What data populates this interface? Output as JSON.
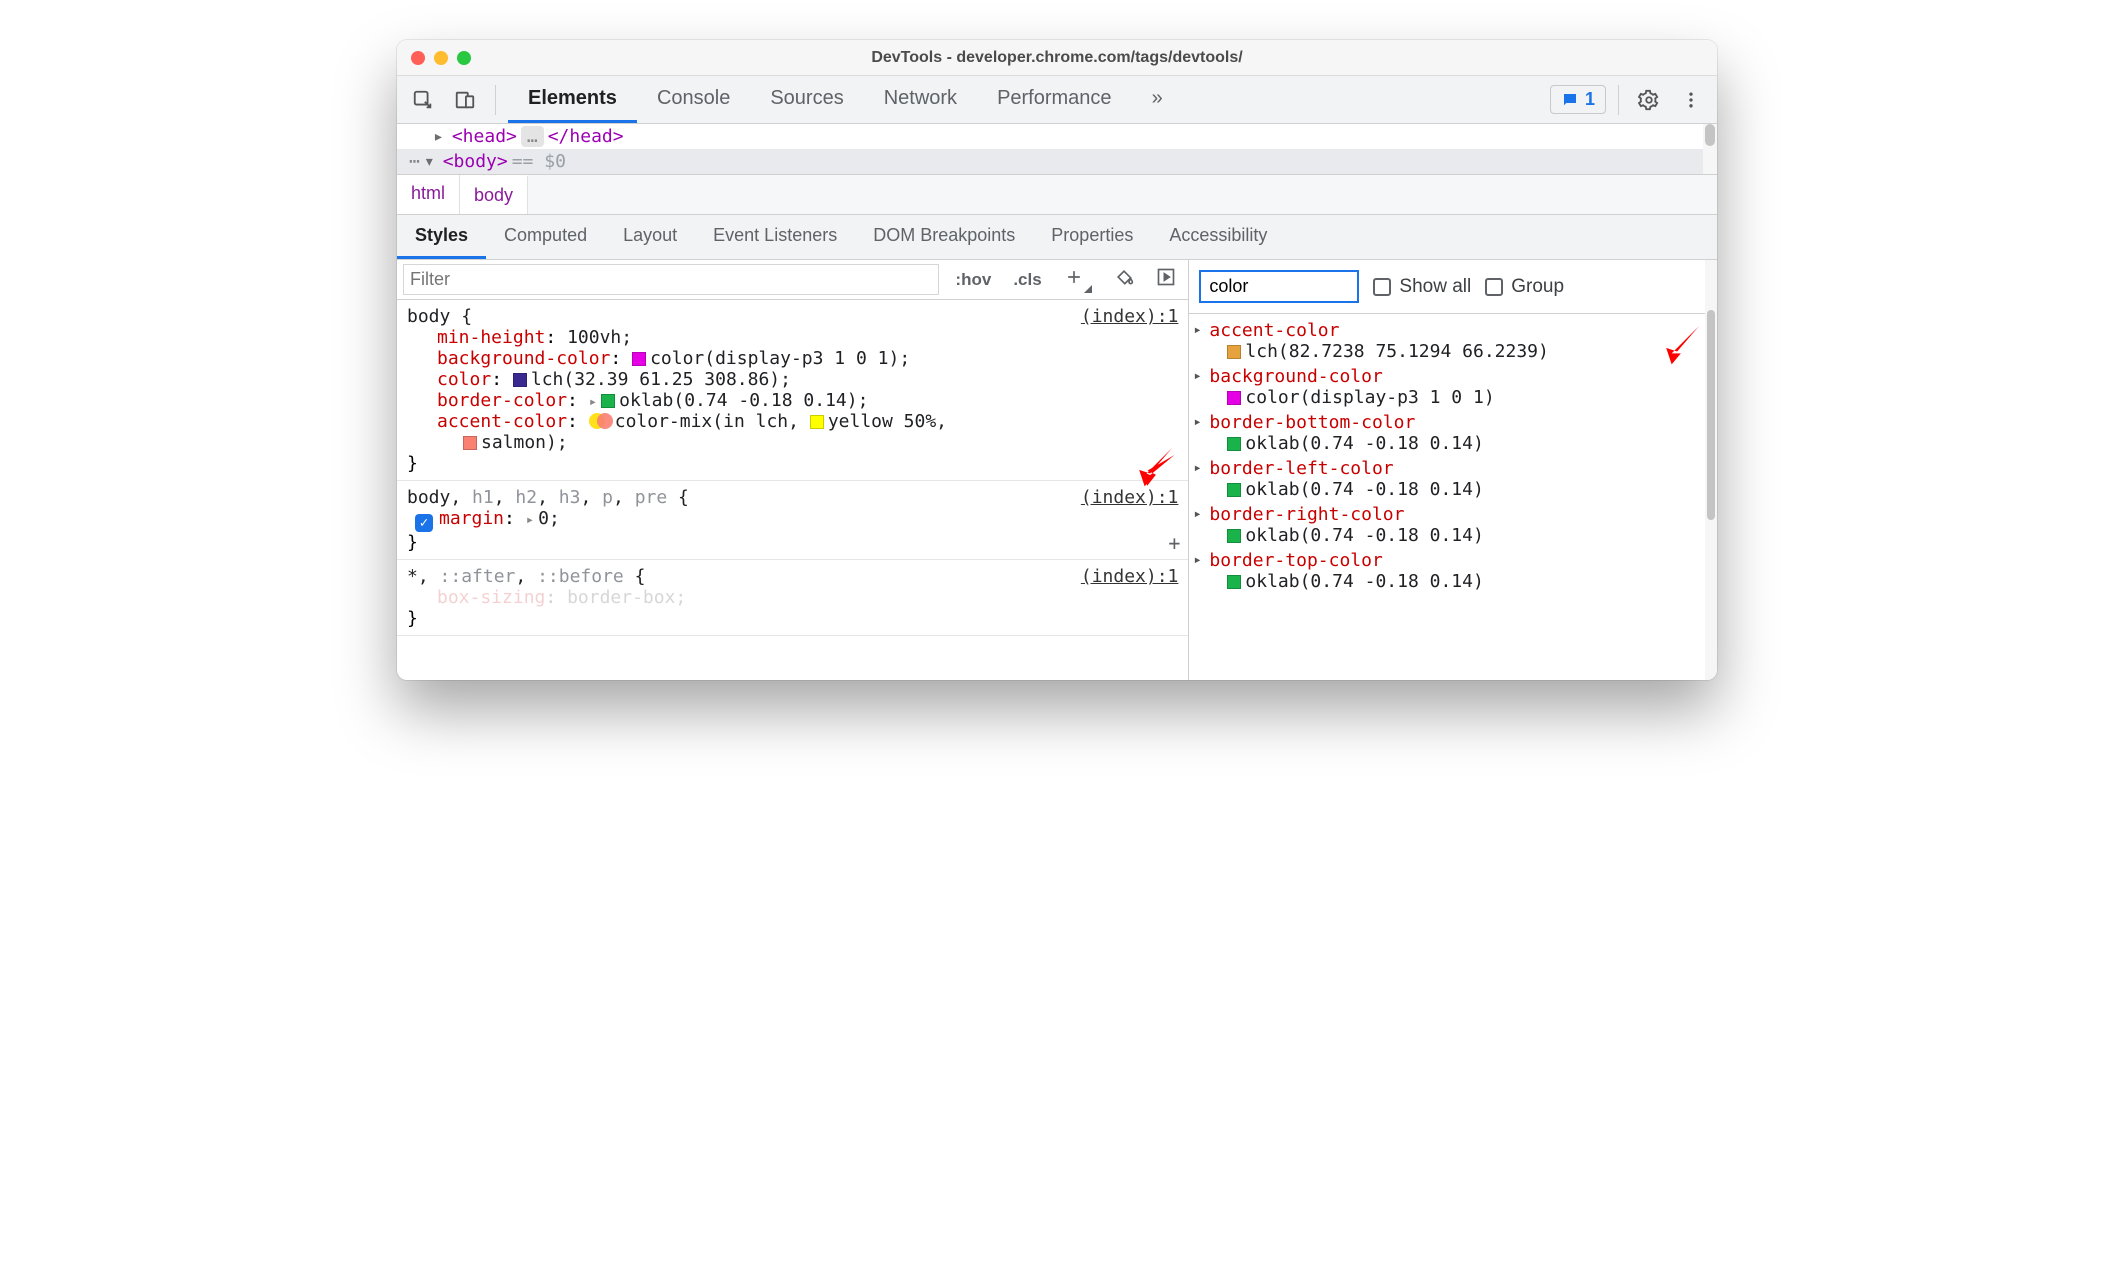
{
  "titlebar": {
    "title": "DevTools - developer.chrome.com/tags/devtools/"
  },
  "toolbar": {
    "tabs": [
      "Elements",
      "Console",
      "Sources",
      "Network",
      "Performance"
    ],
    "more_glyph": "»",
    "badge_count": "1"
  },
  "dom": {
    "head_open": "<head>",
    "head_close": "</head>",
    "ellipsis": "…",
    "dots": "⋯",
    "body_open": "<body>",
    "eq": "== $0"
  },
  "crumbs": [
    "html",
    "body"
  ],
  "subtabs": [
    "Styles",
    "Computed",
    "Layout",
    "Event Listeners",
    "DOM Breakpoints",
    "Properties",
    "Accessibility"
  ],
  "styles_bar": {
    "filter_placeholder": "Filter",
    "hov": ":hov",
    "cls": ".cls"
  },
  "rules": [
    {
      "selector_parts": [
        {
          "t": "body",
          "dim": false
        }
      ],
      "source": "(index):1",
      "decls": [
        {
          "name": "min-height",
          "value": "100vh"
        },
        {
          "name": "background-color",
          "swatch": "#e600e6",
          "value": "color(display-p3 1 0 1)"
        },
        {
          "name": "color",
          "swatch": "#3a2a8f",
          "value": "lch(32.39 61.25 308.86)"
        },
        {
          "name": "border-color",
          "arrow": true,
          "swatch": "#19b24b",
          "value": "oklab(0.74 -0.18 0.14)"
        },
        {
          "name": "accent-color",
          "circles": true,
          "value_pre": "color-mix(in lch, ",
          "mix_swatch": "#ffff00",
          "mix_text": "yellow 50%,",
          "cont_swatch": "#fa8072",
          "cont_text": "salmon)"
        }
      ]
    },
    {
      "selector_parts": [
        {
          "t": "body",
          "dim": false
        },
        {
          "t": ", ",
          "dim": false
        },
        {
          "t": "h1",
          "dim": true
        },
        {
          "t": ", ",
          "dim": false
        },
        {
          "t": "h2",
          "dim": true
        },
        {
          "t": ", ",
          "dim": false
        },
        {
          "t": "h3",
          "dim": true
        },
        {
          "t": ", ",
          "dim": false
        },
        {
          "t": "p",
          "dim": true
        },
        {
          "t": ", ",
          "dim": false
        },
        {
          "t": "pre",
          "dim": true
        }
      ],
      "source": "(index):1",
      "decls": [
        {
          "checked": true,
          "name": "margin",
          "arrow": true,
          "value": "0"
        }
      ],
      "addbtn": true
    },
    {
      "selector_parts": [
        {
          "t": "*",
          "dim": false
        },
        {
          "t": ", ",
          "dim": false
        },
        {
          "t": "::after",
          "dim": true
        },
        {
          "t": ", ",
          "dim": false
        },
        {
          "t": "::before",
          "dim": true
        }
      ],
      "source": "(index):1",
      "decls": [
        {
          "name": "box-sizing",
          "value": "border-box",
          "faded": true
        }
      ]
    }
  ],
  "computed": {
    "filter_value": "color",
    "show_all": "Show all",
    "group": "Group",
    "rows": [
      {
        "name": "accent-color",
        "swatch": "#e6a23c",
        "value": "lch(82.7238 75.1294 66.2239)"
      },
      {
        "name": "background-color",
        "swatch": "#e600e6",
        "value": "color(display-p3 1 0 1)"
      },
      {
        "name": "border-bottom-color",
        "swatch": "#19b24b",
        "value": "oklab(0.74 -0.18 0.14)"
      },
      {
        "name": "border-left-color",
        "swatch": "#19b24b",
        "value": "oklab(0.74 -0.18 0.14)"
      },
      {
        "name": "border-right-color",
        "swatch": "#19b24b",
        "value": "oklab(0.74 -0.18 0.14)"
      },
      {
        "name": "border-top-color",
        "swatch": "#19b24b",
        "value": "oklab(0.74 -0.18 0.14)"
      }
    ]
  },
  "plus": "+",
  "brace_open": " {",
  "brace_close": "}",
  "semicolon": ";"
}
